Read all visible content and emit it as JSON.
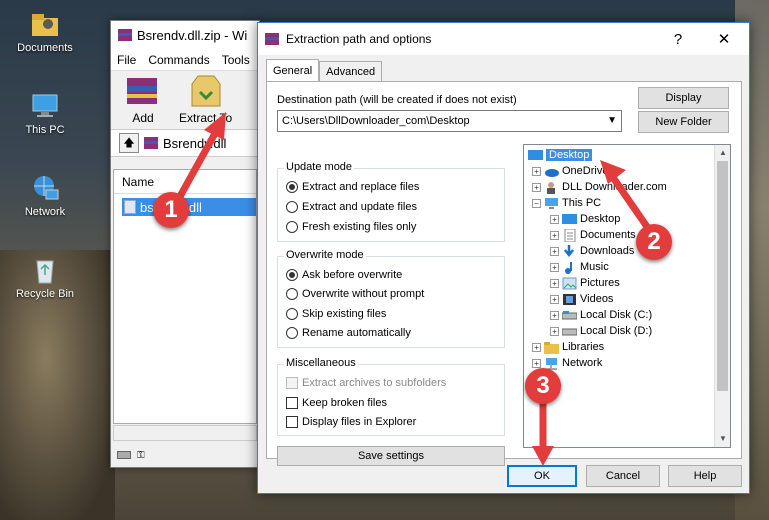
{
  "desktop": {
    "icons": [
      {
        "label": "Documents"
      },
      {
        "label": "This PC"
      },
      {
        "label": "Network"
      },
      {
        "label": "Recycle Bin"
      }
    ]
  },
  "winrar": {
    "title": "Bsrendv.dll.zip - Wi",
    "menu": [
      "File",
      "Commands",
      "Tools"
    ],
    "toolbar": {
      "add": "Add",
      "extract_to": "Extract To"
    },
    "path": "Bsrendv.dll",
    "column_name": "Name",
    "file_row": "bsrendv.dll"
  },
  "dialog": {
    "title": "Extraction path and options",
    "help_glyph": "?",
    "close_glyph": "✕",
    "tabs": [
      "General",
      "Advanced"
    ],
    "dest_label": "Destination path (will be created if does not exist)",
    "dest_value": "C:\\Users\\DllDownloader_com\\Desktop",
    "display_btn": "Display",
    "new_folder_btn": "New Folder",
    "update_mode": {
      "title": "Update mode",
      "options": [
        "Extract and replace files",
        "Extract and update files",
        "Fresh existing files only"
      ],
      "selected": 0
    },
    "overwrite_mode": {
      "title": "Overwrite mode",
      "options": [
        "Ask before overwrite",
        "Overwrite without prompt",
        "Skip existing files",
        "Rename automatically"
      ],
      "selected": 0
    },
    "misc": {
      "title": "Miscellaneous",
      "options": [
        "Extract archives to subfolders",
        "Keep broken files",
        "Display files in Explorer"
      ]
    },
    "save_settings": "Save settings",
    "tree": [
      {
        "label": "Desktop"
      },
      {
        "label": "OneDrive"
      },
      {
        "label": "DLL Downloader.com"
      },
      {
        "label": "This PC"
      },
      {
        "label": "Desktop"
      },
      {
        "label": "Documents"
      },
      {
        "label": "Downloads"
      },
      {
        "label": "Music"
      },
      {
        "label": "Pictures"
      },
      {
        "label": "Videos"
      },
      {
        "label": "Local Disk (C:)"
      },
      {
        "label": "Local Disk (D:)"
      },
      {
        "label": "Libraries"
      },
      {
        "label": "Network"
      }
    ],
    "ok": "OK",
    "cancel": "Cancel",
    "help": "Help"
  },
  "annotations": [
    "1",
    "2",
    "3"
  ],
  "colors": {
    "annotation": "#e23c3c",
    "selection": "#3b8ee6",
    "focus": "#0078d7"
  }
}
